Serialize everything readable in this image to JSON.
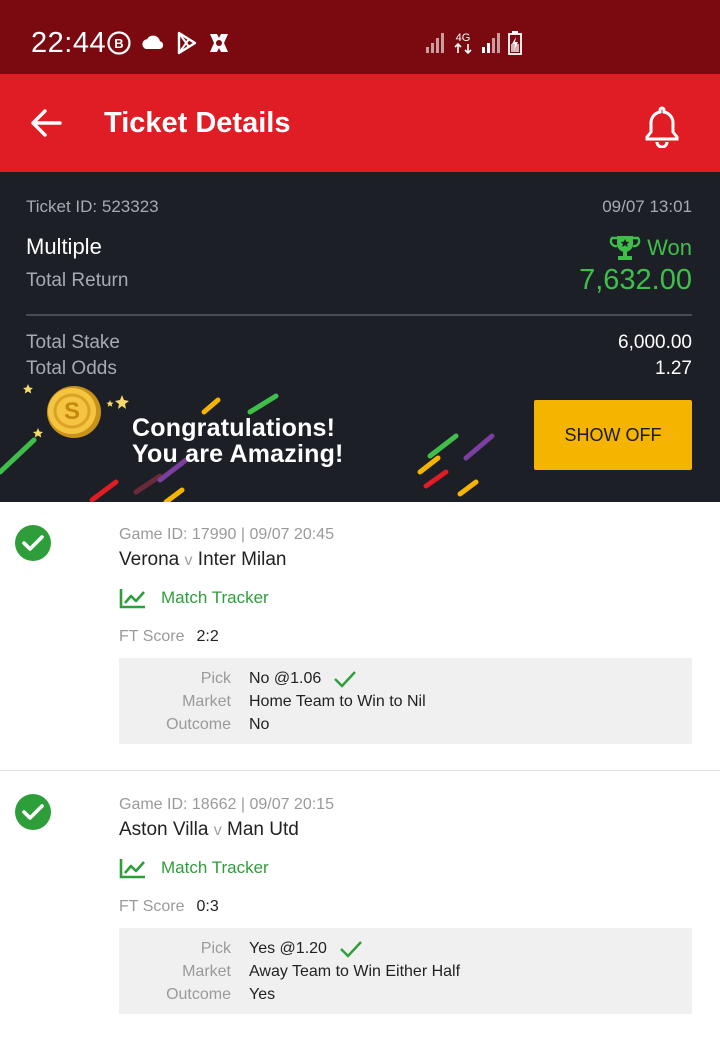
{
  "status_bar": {
    "time": "22:44",
    "icons": [
      "b-circle-icon",
      "cloud-icon",
      "play-store-icon",
      "app-icon",
      "signal-icon",
      "4g-icon",
      "signal-icon",
      "battery-icon"
    ],
    "network_label": "4G"
  },
  "app_bar": {
    "title": "Ticket Details",
    "back_icon": "arrow-left-icon",
    "notification_icon": "bell-icon",
    "bar_color": "#e01c25"
  },
  "summary": {
    "ticket_id": "Ticket ID: 523323",
    "date": "09/07 13:01",
    "bet_type": "Multiple",
    "status": "Won",
    "total_return_label": "Total Return",
    "total_return_value": "7,632.00",
    "total_stake_label": "Total Stake",
    "total_stake_value": "6,000.00",
    "total_odds_label": "Total Odds",
    "total_odds_value": "1.27",
    "won_color": "#3fbf4a"
  },
  "banner": {
    "line1": "Congratulations!",
    "line2": "You are Amazing!",
    "button_label": "SHOW OFF",
    "button_color": "#f5b400",
    "coin_symbol": "S"
  },
  "games": [
    {
      "game_id": "Game ID: 17990 | 09/07 20:45",
      "home": "Verona",
      "vs": "v",
      "away": "Inter Milan",
      "tracker_label": "Match Tracker",
      "ft_label": "FT Score",
      "ft_score": "2:2",
      "pick_label": "Pick",
      "pick_value": "No @1.06",
      "market_label": "Market",
      "market_value": "Home Team to Win to Nil",
      "outcome_label": "Outcome",
      "outcome_value": "No"
    },
    {
      "game_id": "Game ID: 18662 | 09/07 20:15",
      "home": "Aston Villa",
      "vs": "v",
      "away": "Man Utd",
      "tracker_label": "Match Tracker",
      "ft_label": "FT Score",
      "ft_score": "0:3",
      "pick_label": "Pick",
      "pick_value": "Yes @1.20",
      "market_label": "Market",
      "market_value": "Away Team to Win Either Half",
      "outcome_label": "Outcome",
      "outcome_value": "Yes"
    }
  ]
}
